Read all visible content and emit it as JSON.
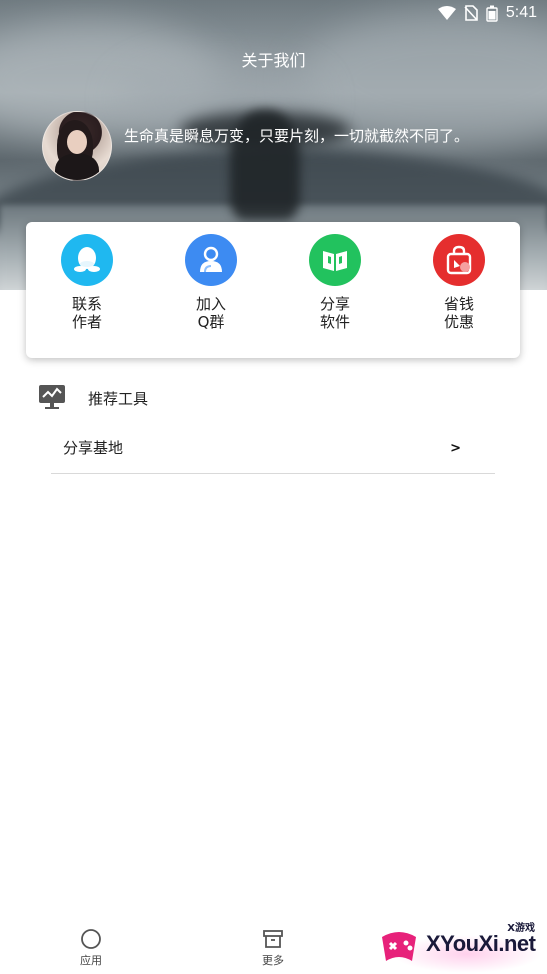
{
  "status_bar": {
    "time": "5:41"
  },
  "header": {
    "title": "关于我们"
  },
  "profile": {
    "motto": "生命真是瞬息万变，只要片刻，一切就截然不同了。"
  },
  "actions": [
    {
      "label": "联系\n作者",
      "icon": "qq-icon",
      "color": "#1fb8f0"
    },
    {
      "label": "加入\nQ群",
      "icon": "group-icon",
      "color": "#3d8bf2"
    },
    {
      "label": "分享\n软件",
      "icon": "book-icon",
      "color": "#22c25e"
    },
    {
      "label": "省钱\n优惠",
      "icon": "shopping-bag-icon",
      "color": "#e52e2e"
    }
  ],
  "section": {
    "title": "推荐工具",
    "icon": "monitor-chart-icon",
    "items": [
      {
        "label": "分享基地",
        "chevron": ">"
      }
    ]
  },
  "bottom_nav": {
    "items": [
      {
        "label": "应用",
        "icon": "circle-icon"
      },
      {
        "label": "更多",
        "icon": "box-icon"
      }
    ]
  },
  "watermark": {
    "site": "XYouXi.net",
    "tag": "X游戏"
  }
}
